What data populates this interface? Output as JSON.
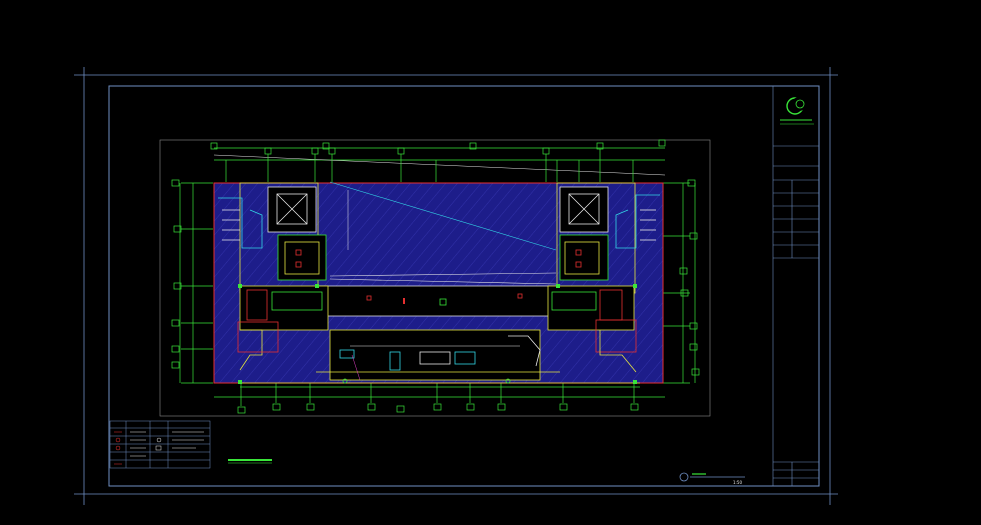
{
  "colors": {
    "background": "#000000",
    "frame": "#6f8fc4",
    "hatch_fill": "#1d1d8a",
    "green": "#39e639",
    "yellow": "#e6e640",
    "red": "#e63030",
    "cyan": "#33d6e6",
    "white": "#e8e8e8",
    "magenta": "#e640c8"
  },
  "title_block": {
    "logo": "crescent-logo",
    "rows": [
      {
        "label": "",
        "value": ""
      },
      {
        "label": "",
        "value": ""
      },
      {
        "label": "",
        "value": ""
      },
      {
        "label": "",
        "value": ""
      },
      {
        "label": "",
        "value": ""
      },
      {
        "label": "",
        "value": ""
      },
      {
        "label": "",
        "value": ""
      },
      {
        "label": "",
        "value": ""
      }
    ]
  },
  "legend": {
    "headers": [
      "",
      "",
      "",
      ""
    ],
    "rows": [
      [
        "",
        "",
        "",
        ""
      ],
      [
        "",
        "",
        "",
        ""
      ],
      [
        "",
        "",
        "",
        ""
      ],
      [
        "",
        "",
        "",
        ""
      ],
      [
        "",
        "",
        "",
        ""
      ]
    ]
  },
  "drawing": {
    "plan_caption": "",
    "scale_label": "1:50"
  }
}
